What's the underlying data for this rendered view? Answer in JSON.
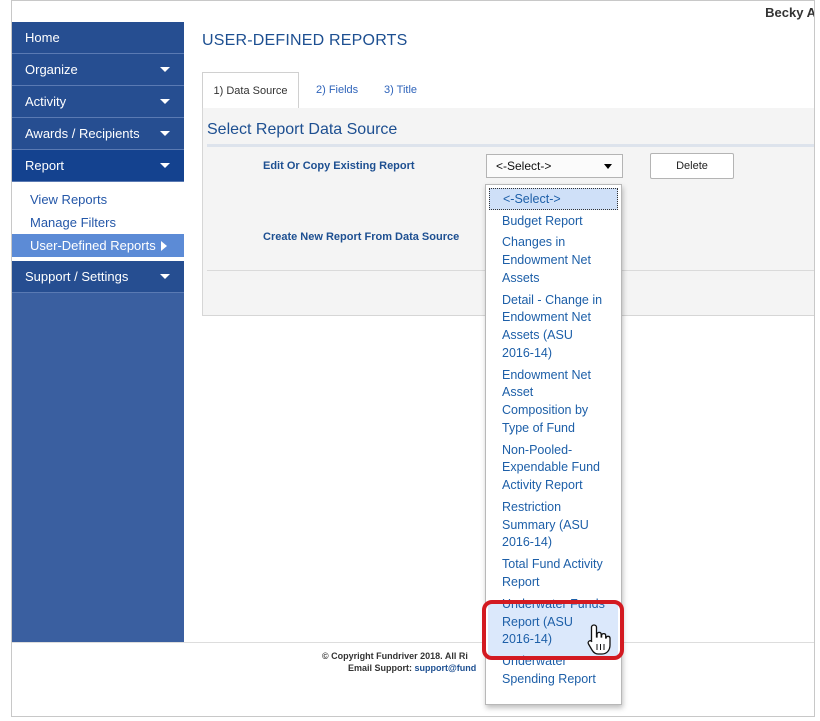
{
  "header": {
    "username": "Becky A"
  },
  "sidebar": {
    "items": [
      {
        "label": "Home"
      },
      {
        "label": "Organize"
      },
      {
        "label": "Activity"
      },
      {
        "label": "Awards / Recipients"
      },
      {
        "label": "Report"
      },
      {
        "label": "Support / Settings"
      }
    ],
    "report_submenu": [
      {
        "label": "View Reports"
      },
      {
        "label": "Manage Filters"
      },
      {
        "label": "User-Defined Reports"
      }
    ]
  },
  "main": {
    "page_title": "USER-DEFINED REPORTS",
    "tabs": [
      {
        "label": "1) Data Source"
      },
      {
        "label": "2) Fields"
      },
      {
        "label": "3) Title"
      }
    ],
    "section_title": "Select Report Data Source",
    "edit_label": "Edit Or Copy Existing Report",
    "create_label": "Create New Report From Data Source",
    "select_value": "<-Select->",
    "delete_label": "Delete"
  },
  "dropdown": {
    "selected": "<-Select->",
    "options": [
      {
        "lines": [
          "Budget Report"
        ]
      },
      {
        "lines": [
          "Changes in",
          "Endowment Net",
          "Assets"
        ]
      },
      {
        "lines": [
          "Detail - Change in",
          "Endowment Net",
          "Assets (ASU",
          "2016-14)"
        ]
      },
      {
        "lines": [
          "Endowment Net",
          "Asset",
          "Composition by",
          "Type of Fund"
        ]
      },
      {
        "lines": [
          "Non-Pooled-",
          "Expendable Fund",
          "Activity Report"
        ]
      },
      {
        "lines": [
          "Restriction",
          "Summary (ASU",
          "2016-14)"
        ]
      },
      {
        "lines": [
          "Total Fund Activity",
          "Report"
        ]
      },
      {
        "lines": [
          "Underwater Funds",
          "Report (ASU",
          "2016-14)"
        ]
      },
      {
        "lines": [
          "Underwater",
          "Spending Report"
        ]
      }
    ]
  },
  "footer": {
    "copyright": "© Copyright Fundriver 2018. All Ri",
    "support_prefix": "Email Support: ",
    "support_link": "support@fund"
  }
}
